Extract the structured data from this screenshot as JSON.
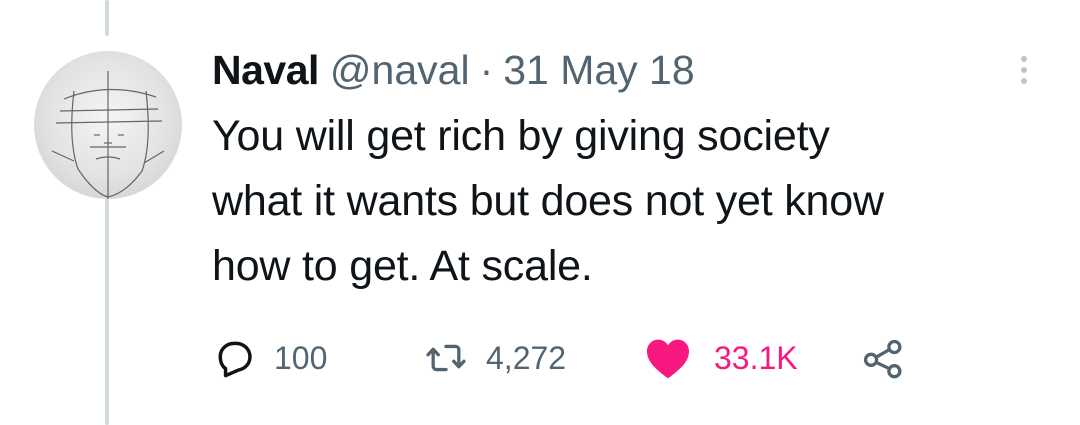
{
  "tweet": {
    "author": {
      "display_name": "Naval",
      "handle": "@naval"
    },
    "separator": "·",
    "date": "31 May 18",
    "text": "You will get rich by giving society\nwhat it wants but does not yet know\nhow to get. At scale.",
    "stats": {
      "replies": "100",
      "retweets": "4,272",
      "likes": "33.1K"
    },
    "liked": true,
    "icons": {
      "more": "more-dots-icon",
      "reply": "reply-icon",
      "retweet": "retweet-icon",
      "like": "heart-icon",
      "share": "share-icon"
    }
  },
  "colors": {
    "text_primary": "#0f1419",
    "text_secondary": "#536471",
    "like_active": "#f91880",
    "thread_line": "#cfd9de"
  }
}
